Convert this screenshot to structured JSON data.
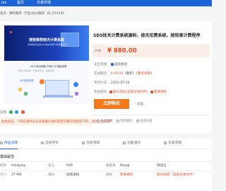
{
  "topbar": {
    "left": "lex",
    "nav1": "首页",
    "nav2": "交易市场"
  },
  "breadcrumb": [
    "首页",
    "源码服务",
    "行业/办公服务",
    "ID_974192"
  ],
  "product": {
    "title": "SEO技关计费系统源码，按天扣费系统，按效果计费程序",
    "price_label": "价格",
    "price": "¥ 880.00",
    "info": {
      "prefix_label": "是否需要",
      "prefix_value": "自动发货",
      "service_label": "在线服务",
      "service_value": "¥ 69.00",
      "service_extra": "(整年)",
      "service_tag": "[整年保障]",
      "update_label": "更新时间",
      "update_value": "2023-07-24",
      "support_label": "售后服务",
      "support_value": "部分源码",
      "support_extra": "(全部分源文件)",
      "support_red": "需要授权"
    },
    "buy_label": "立即购买",
    "fav_label": "收藏"
  },
  "image": {
    "banner_title": "搜狗推荐按天计费系统",
    "banner_sub": "支持搜狗/百度/360等多搜索引擎按天计费",
    "sub_title": "2023年全新版  节省人力 提高效率",
    "sub_line": "按天计费系统 · 支持多平台 · 自动扣费",
    "sub_title2": "SEO按天扣费"
  },
  "share_label": "分享",
  "warning": "此类商品，下单前请务必与卖家确认源码是否完整可用后再下单，谨防上当受骗！",
  "services": [
    "正品保障",
    "售后服务",
    "资金托管"
  ],
  "tabs": [
    {
      "label": "商品详情",
      "active": true
    },
    {
      "label": "交易评价",
      "active": false
    },
    {
      "label": "交易须知",
      "active": false
    },
    {
      "label": "功能演示",
      "active": false
    },
    {
      "label": "交易流程",
      "active": false
    }
  ],
  "attributes": {
    "heading": "基础属性",
    "rows": [
      [
        {
          "k": "框架",
          "v": "thinkphp"
        },
        {
          "k": "语言",
          "v": "PHP"
        },
        {
          "k": "数据库",
          "v": "Mysql"
        },
        {
          "k": "",
          "v": "单语言"
        }
      ],
      [
        {
          "k": "大小",
          "v": "27 MB"
        },
        {
          "k": "源码",
          "v": "加密源码"
        },
        {
          "k": "授权",
          "v": "需要授权",
          "red": true
        },
        {
          "k": "",
          "v": "部分加密（含部分源文件）",
          "red": true
        }
      ]
    ]
  },
  "colors": {
    "primary": "#1d63d8",
    "accent": "#f27a1a",
    "price": "#e8502b"
  }
}
